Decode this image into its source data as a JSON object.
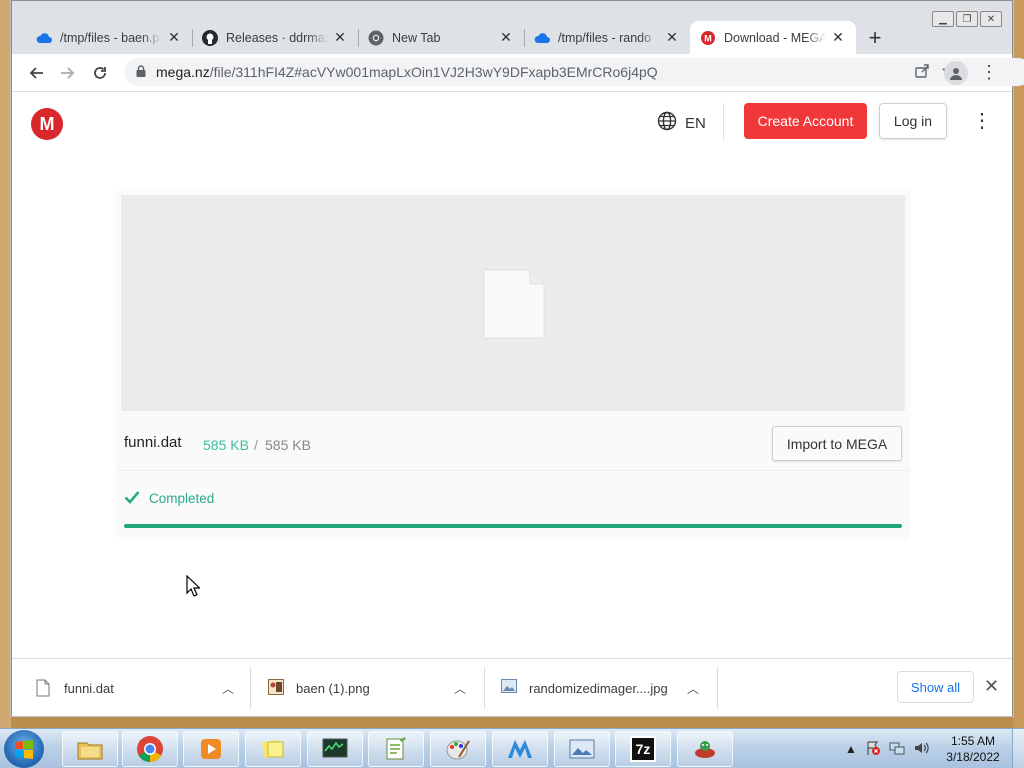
{
  "browser": {
    "tabs": [
      {
        "title": "/tmp/files - baen.p",
        "icon": "cloud-icon"
      },
      {
        "title": "Releases · ddrmax",
        "icon": "github-icon"
      },
      {
        "title": "New Tab",
        "icon": "chrome-icon"
      },
      {
        "title": "/tmp/files - rando",
        "icon": "cloud-icon"
      },
      {
        "title": "Download - MEGA",
        "icon": "mega-icon",
        "active": true
      }
    ],
    "new_tab_label": "+",
    "url_host": "mega.nz",
    "url_path": "/file/311hFI4Z#acVYw001mapLxOin1VJ2H3wY9DFxapb3EMrCRo6j4pQ"
  },
  "header": {
    "logo_letter": "M",
    "language": "EN",
    "create_account": "Create Account",
    "login": "Log in"
  },
  "file": {
    "name": "funni.dat",
    "downloaded": "585 KB",
    "separator": "/",
    "total": "585 KB",
    "import_label": "Import to MEGA",
    "status": "Completed",
    "progress": 1.0
  },
  "downloads": {
    "items": [
      {
        "name": "funni.dat",
        "icon": "file-icon"
      },
      {
        "name": "baen (1).png",
        "icon": "image-icon"
      },
      {
        "name": "randomizedimager....jpg",
        "icon": "image-icon"
      }
    ],
    "show_all": "Show all"
  },
  "taskbar": {
    "time": "1:55 AM",
    "date": "3/18/2022",
    "items": [
      "file-explorer-icon",
      "chrome-icon",
      "media-player-icon",
      "sticky-notes-icon",
      "task-manager-icon",
      "notepad-icon",
      "paint-icon",
      "app-m-icon",
      "photo-viewer-icon",
      "7zip-icon",
      "game-icon"
    ],
    "sevenzip_label": "7z"
  },
  "colors": {
    "mega_red": "#d9272e",
    "create_button": "#f0373a",
    "completed_green": "#2ba888",
    "size_teal": "#3cbea0",
    "link_blue": "#1a73e8"
  }
}
